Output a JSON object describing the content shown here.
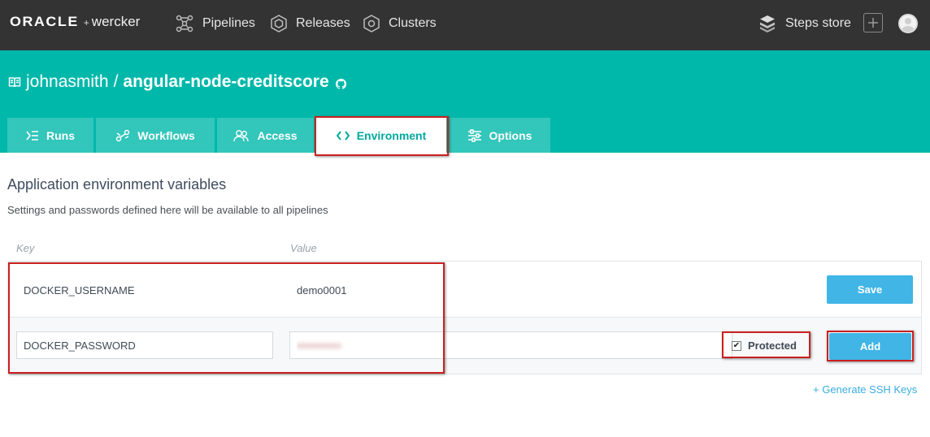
{
  "topbar": {
    "brand_oracle": "ORACLE",
    "brand_plus": "+",
    "brand_wercker": "wercker",
    "nav": {
      "pipelines": "Pipelines",
      "releases": "Releases",
      "clusters": "Clusters",
      "steps_store": "Steps store"
    },
    "icons": [
      "pipelines-icon",
      "releases-icon",
      "clusters-icon",
      "steps-store-icon",
      "plus-icon",
      "avatar"
    ]
  },
  "header": {
    "owner": "johnasmith",
    "separator": "/",
    "repo": "angular-node-creditscore",
    "tabs": [
      {
        "label": "Runs",
        "icon": "runs-icon"
      },
      {
        "label": "Workflows",
        "icon": "workflows-icon"
      },
      {
        "label": "Access",
        "icon": "access-icon"
      },
      {
        "label": "Environment",
        "icon": "code-icon",
        "active": true
      },
      {
        "label": "Options",
        "icon": "options-icon"
      }
    ]
  },
  "main": {
    "title": "Application environment variables",
    "description": "Settings and passwords defined here will be available to all pipelines",
    "columns": {
      "key": "Key",
      "value": "Value"
    },
    "rows": [
      {
        "key": "DOCKER_USERNAME",
        "value": "demo0001",
        "action": "Save"
      },
      {
        "key": "DOCKER_PASSWORD",
        "value": "••••••••••••",
        "protected_label": "Protected",
        "protected": true,
        "action": "Add"
      }
    ],
    "generate_ssh": "+ Generate SSH Keys"
  },
  "colors": {
    "topbar": "#333333",
    "band": "#00b8aa",
    "tab": "#33c6bb",
    "button": "#40b5e6",
    "highlight": "#c9201f"
  }
}
